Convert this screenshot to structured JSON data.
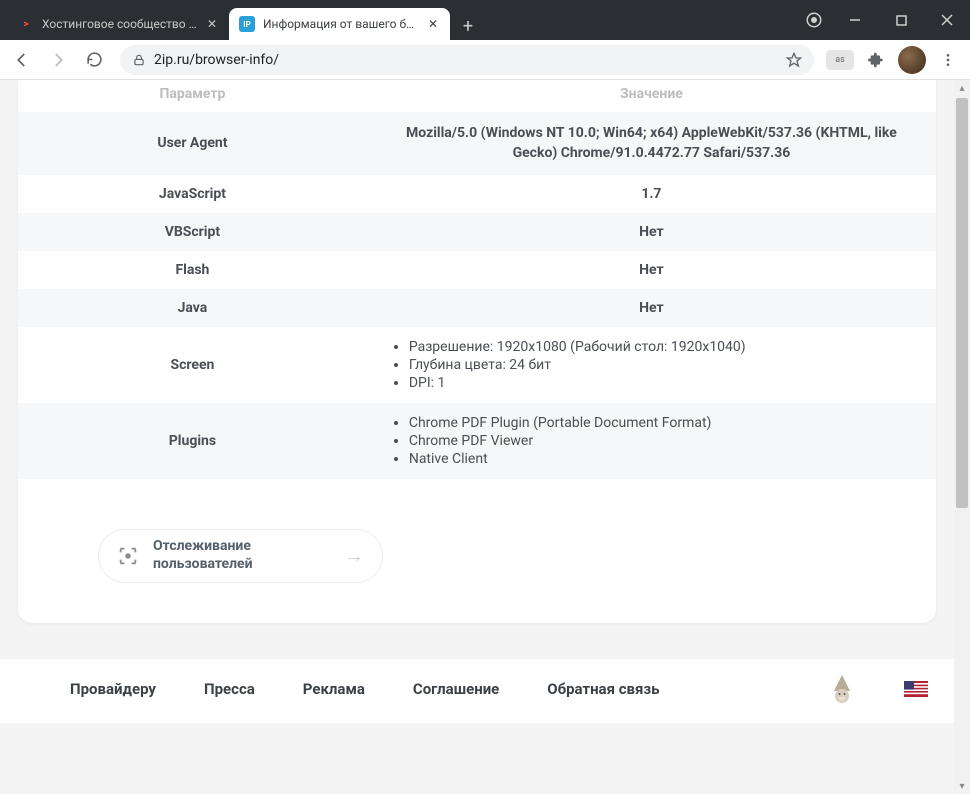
{
  "browser": {
    "tabs": [
      {
        "title": "Хостинговое сообщество «Time...",
        "favicon": ">"
      },
      {
        "title": "Информация от вашего браузе...",
        "favicon": "IP"
      }
    ],
    "url": "2ip.ru/browser-info/"
  },
  "table": {
    "header_param": "Параметр",
    "header_value": "Значение",
    "rows": {
      "ua_k": "User Agent",
      "ua_v": "Mozilla/5.0 (Windows NT 10.0; Win64; x64) AppleWebKit/537.36 (KHTML, like Gecko) Chrome/91.0.4472.77 Safari/537.36",
      "js_k": "JavaScript",
      "js_v": "1.7",
      "vbs_k": "VBScript",
      "vbs_v": "Нет",
      "flash_k": "Flash",
      "flash_v": "Нет",
      "java_k": "Java",
      "java_v": "Нет",
      "screen_k": "Screen",
      "screen_items": [
        "Разрешение: 1920x1080 (Рабочий стол: 1920x1040)",
        "Глубина цвета: 24 бит",
        "DPI: 1"
      ],
      "plugins_k": "Plugins",
      "plugins_items": [
        "Chrome PDF Plugin (Portable Document Format)",
        "Chrome PDF Viewer",
        "Native Client"
      ]
    }
  },
  "promo": {
    "line1": "Отслеживание",
    "line2": "пользователей"
  },
  "footer": {
    "links": [
      "Провайдеру",
      "Пресса",
      "Реклама",
      "Соглашение",
      "Обратная связь"
    ]
  }
}
